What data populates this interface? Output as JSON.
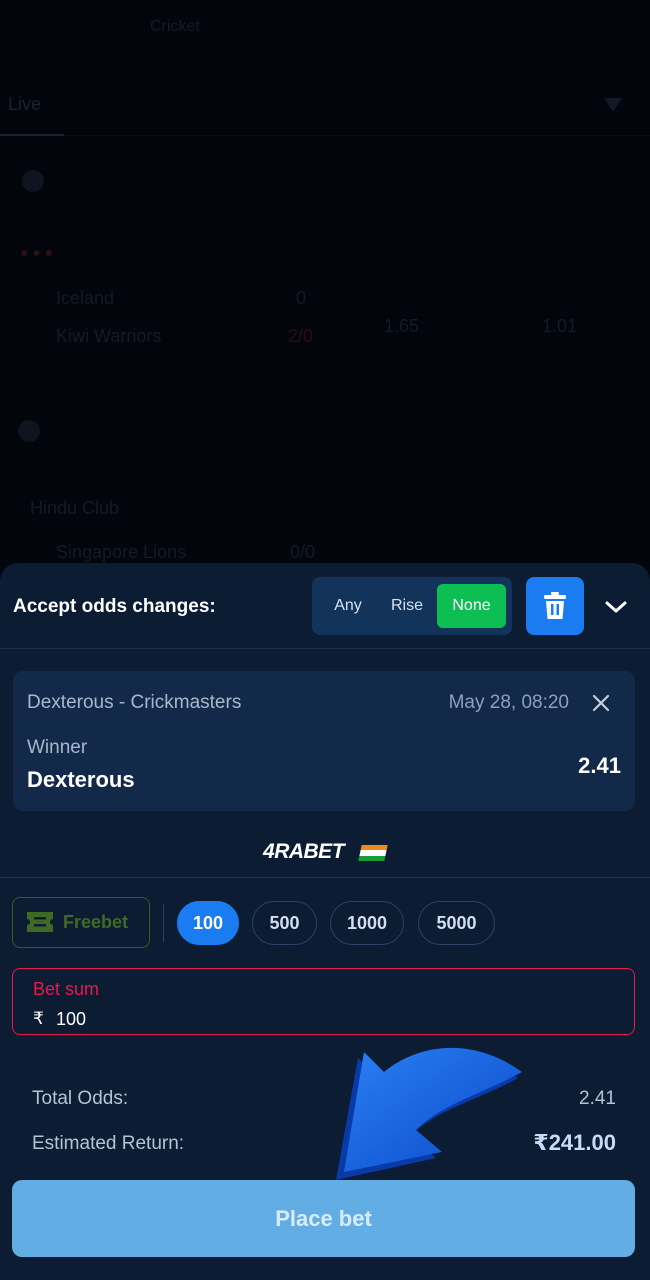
{
  "background": {
    "top_tab": "Cricket",
    "nav_live": "Live",
    "rows": [
      {
        "team": "Iceland",
        "score": "0"
      },
      {
        "team": "Kiwi Warriors",
        "score": "2/0",
        "odds1": "1.65",
        "odds2": "1.01"
      },
      {
        "team": "Hindu Club",
        "score": ""
      },
      {
        "team": "Singapore Lions",
        "score": "0/0"
      }
    ]
  },
  "betslip": {
    "accept_label": "Accept odds changes:",
    "options": [
      "Any",
      "Rise",
      "None"
    ],
    "selected_option": "None",
    "bet": {
      "match": "Dexterous - Crickmasters",
      "date": "May 28, 08:20",
      "market": "Winner",
      "selection": "Dexterous",
      "odds": "2.41"
    },
    "logo": {
      "prefix": "4",
      "text": "RABET"
    },
    "freebet_label": "Freebet",
    "chips": [
      "100",
      "500",
      "1000",
      "5000"
    ],
    "active_chip": "100",
    "bet_sum": {
      "label": "Bet sum",
      "currency": "₹",
      "value": "100"
    },
    "total_odds_label": "Total Odds:",
    "total_odds": "2.41",
    "return_label": "Estimated Return:",
    "return_value": "₹241.00",
    "place_label": "Place bet"
  },
  "colors": {
    "sheet_bg": "#0b1c33",
    "accent_blue": "#1a7cf0",
    "active_green": "#0dbf52",
    "error_red": "#e8194b",
    "place_button": "#62aee4"
  }
}
